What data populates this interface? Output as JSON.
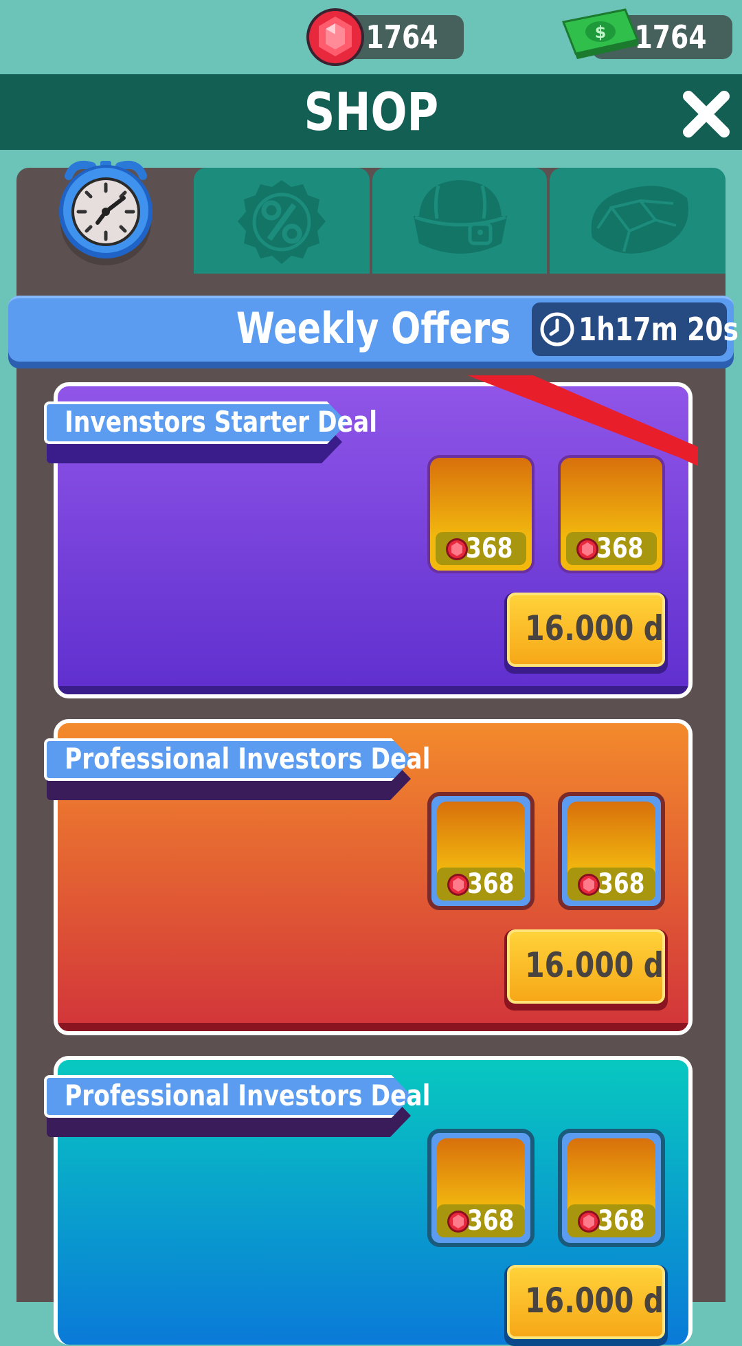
{
  "currencies": {
    "gems": {
      "value": "1764",
      "icon": "ruby-gem-icon",
      "color": "#e8283c"
    },
    "cash": {
      "value": "1764",
      "icon": "cash-stack-icon",
      "color": "#2fbf4a"
    }
  },
  "header": {
    "title": "SHOP",
    "close_icon": "close-icon"
  },
  "tabs": [
    {
      "icon": "alarm-clock-icon",
      "active": true
    },
    {
      "icon": "discount-badge-icon",
      "active": false
    },
    {
      "icon": "treasure-chest-icon",
      "active": false
    },
    {
      "icon": "gem-icon",
      "active": false
    }
  ],
  "weekly": {
    "title": "Weekly Offers",
    "timer": "1h17m 20s",
    "timer_icon": "clock-icon"
  },
  "offers": [
    {
      "name": "Invenstors Starter Deal",
      "items": [
        {
          "price": "368"
        },
        {
          "price": "368"
        }
      ],
      "buy_label": "16.000 d",
      "theme": "#7a44e0"
    },
    {
      "name": "Professional Investors Deal",
      "items": [
        {
          "price": "368"
        },
        {
          "price": "368"
        }
      ],
      "buy_label": "16.000 d",
      "theme": "#e24a2c"
    },
    {
      "name": "Professional Investors Deal",
      "items": [
        {
          "price": "368"
        },
        {
          "price": "368"
        }
      ],
      "buy_label": "16.000 d",
      "theme": "#0aa8d6"
    }
  ]
}
